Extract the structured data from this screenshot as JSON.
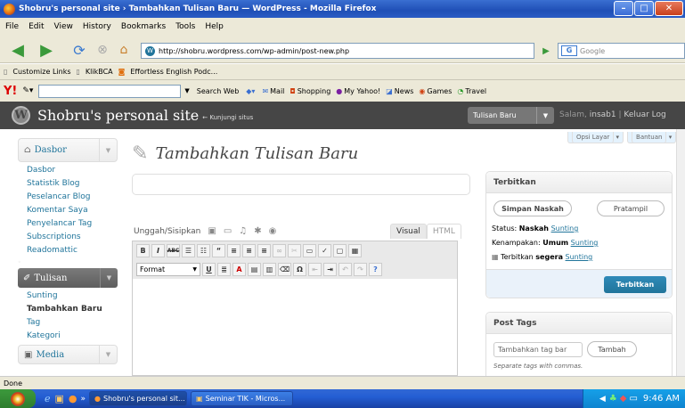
{
  "window": {
    "title": "Shobru's personal site › Tambahkan Tulisan Baru — WordPress - Mozilla Firefox"
  },
  "menubar": [
    "File",
    "Edit",
    "View",
    "History",
    "Bookmarks",
    "Tools",
    "Help"
  ],
  "nav": {
    "url": "http://shobru.wordpress.com/wp-admin/post-new.php",
    "search_placeholder": "Google"
  },
  "bookmarks": [
    "Customize Links",
    "KlikBCA",
    "Effortless English Podc..."
  ],
  "yahoo_toolbar": {
    "search_web": "Search Web",
    "items": [
      "Mail",
      "Shopping",
      "My Yahoo!",
      "News",
      "Games",
      "Travel"
    ]
  },
  "wp_header": {
    "site_name": "Shobru's personal site",
    "visit_site": "← Kunjungi situs",
    "favorite_action": "Tulisan Baru",
    "greeting": "Salam,",
    "username": "insab1",
    "separator": "|",
    "logout": "Keluar Log"
  },
  "sidebar": {
    "dashboard": {
      "label": "Dasbor",
      "items": [
        "Dasbor",
        "Statistik Blog",
        "Peselancar Blog",
        "Komentar Saya",
        "Penyelancar Tag",
        "Subscriptions",
        "Readomattic"
      ]
    },
    "posts": {
      "label": "Tulisan",
      "items": [
        "Sunting",
        "Tambahkan Baru",
        "Tag",
        "Kategori"
      ]
    },
    "media": {
      "label": "Media"
    }
  },
  "main": {
    "screen_options": "Opsi Layar",
    "help": "Bantuan",
    "page_title": "Tambahkan Tulisan Baru",
    "upload_label": "Unggah/Sisipkan",
    "tab_visual": "Visual",
    "tab_html": "HTML",
    "format_select": "Format"
  },
  "publish_box": {
    "title": "Terbitkan",
    "save_draft": "Simpan Naskah",
    "preview": "Pratampil",
    "status_label": "Status:",
    "status_value": "Naskah",
    "visibility_label": "Kenampakan:",
    "visibility_value": "Umum",
    "publish_time_label": "Terbitkan",
    "publish_time_value": "segera",
    "edit_link": "Sunting",
    "publish_button": "Terbitkan"
  },
  "tags_box": {
    "title": "Post Tags",
    "input_placeholder": "Tambahkan tag bar",
    "add_button": "Tambah",
    "hint": "Separate tags with commas."
  },
  "statusbar": {
    "text": "Done"
  },
  "taskbar": {
    "tasks": [
      "Shobru's personal sit...",
      "Seminar TIK - Micros..."
    ],
    "clock": "9:46 AM"
  }
}
